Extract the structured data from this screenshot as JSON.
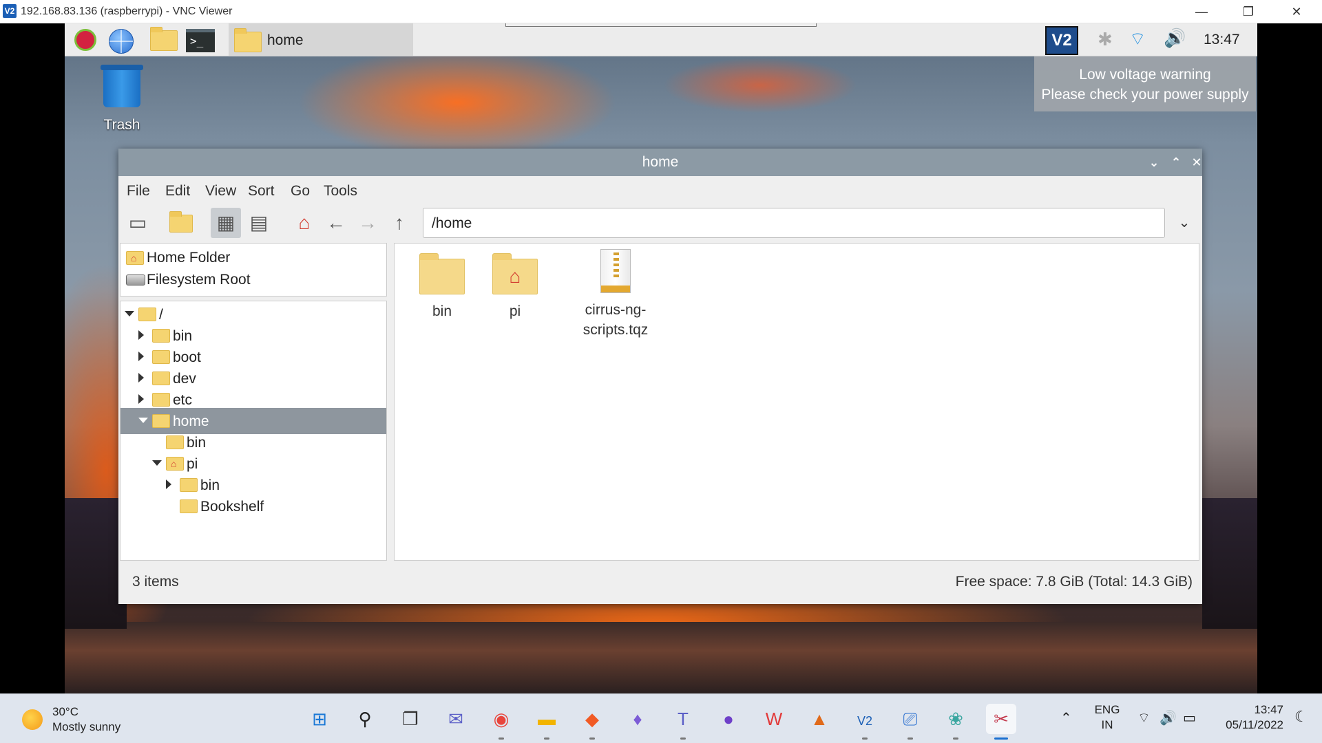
{
  "vnc": {
    "title": "192.168.83.136 (raspberrypi) - VNC Viewer",
    "logo": "V2",
    "controls": {
      "minimize": "—",
      "restore": "❐",
      "close": "✕"
    }
  },
  "pi_panel": {
    "launchers": [
      "raspberry-menu-icon",
      "web-browser-icon",
      "file-manager-icon",
      "terminal-icon"
    ],
    "terminal_glyph": ">_",
    "task_button": "home",
    "tray": {
      "vnc": "V2",
      "bluetooth": "✱",
      "wifi": "⌔",
      "volume": "🔊",
      "clock": "13:47"
    }
  },
  "tooltip": {
    "line1": "Low voltage warning",
    "line2": "Please check your power supply"
  },
  "desktop": {
    "trash_label": "Trash"
  },
  "file_manager": {
    "title": "home",
    "title_buttons": {
      "minimize": "⌄",
      "maximize": "⌃",
      "close": "✕"
    },
    "menu": [
      "File",
      "Edit",
      "View",
      "Sort",
      "Go",
      "Tools"
    ],
    "toolbar": {
      "new_window": "▭",
      "new_folder": "",
      "icon_view": "▦",
      "list_view": "▤",
      "home": "⌂",
      "back": "←",
      "forward": "→",
      "up": "↑"
    },
    "path": "/home",
    "places": [
      {
        "label": "Home Folder"
      },
      {
        "label": "Filesystem Root"
      }
    ],
    "tree": [
      {
        "label": "/",
        "level": 0,
        "state": "expanded"
      },
      {
        "label": "bin",
        "level": 1,
        "state": "collapsed"
      },
      {
        "label": "boot",
        "level": 1,
        "state": "collapsed"
      },
      {
        "label": "dev",
        "level": 1,
        "state": "collapsed"
      },
      {
        "label": "etc",
        "level": 1,
        "state": "collapsed"
      },
      {
        "label": "home",
        "level": 1,
        "state": "expanded",
        "selected": true
      },
      {
        "label": "bin",
        "level": 2,
        "state": "leaf"
      },
      {
        "label": "pi",
        "level": 2,
        "state": "expanded",
        "home": true
      },
      {
        "label": "bin",
        "level": 3,
        "state": "collapsed"
      },
      {
        "label": "Bookshelf",
        "level": 3,
        "state": "leaf"
      }
    ],
    "files": [
      {
        "name": "bin",
        "type": "folder"
      },
      {
        "name": "pi",
        "type": "home-folder"
      },
      {
        "name": "cirrus-ng-scripts.tqz",
        "type": "archive"
      }
    ],
    "status_left": "3 items",
    "status_right": "Free space: 7.8 GiB (Total: 14.3 GiB)"
  },
  "windows_taskbar": {
    "weather": {
      "temp": "30°C",
      "desc": "Mostly sunny"
    },
    "apps": [
      {
        "name": "start",
        "glyph": "⊞",
        "color": "#1a78d6"
      },
      {
        "name": "search",
        "glyph": "⚲",
        "color": "#222222"
      },
      {
        "name": "task-view",
        "glyph": "❐",
        "color": "#333333"
      },
      {
        "name": "chat",
        "glyph": "✉",
        "color": "#5b5fc7"
      },
      {
        "name": "chrome",
        "glyph": "◉",
        "color": "#e8453c"
      },
      {
        "name": "file-explorer",
        "glyph": "▬",
        "color": "#f2b400"
      },
      {
        "name": "brave",
        "glyph": "◆",
        "color": "#f15a24"
      },
      {
        "name": "obsidian",
        "glyph": "♦",
        "color": "#7c5cd6"
      },
      {
        "name": "teams",
        "glyph": "T",
        "color": "#5b5fc7"
      },
      {
        "name": "github-desktop",
        "glyph": "●",
        "color": "#6e40c9"
      },
      {
        "name": "wps",
        "glyph": "W",
        "color": "#e23b3b"
      },
      {
        "name": "matlab",
        "glyph": "▲",
        "color": "#e06a1a"
      },
      {
        "name": "vnc-viewer",
        "glyph": "V2",
        "color": "#1b5fb6"
      },
      {
        "name": "remote-desktop",
        "glyph": "⎚",
        "color": "#2a6fd0"
      },
      {
        "name": "paw-app",
        "glyph": "❀",
        "color": "#3aa6a0"
      },
      {
        "name": "snipping-tool",
        "glyph": "✂",
        "color": "#c3364a"
      }
    ],
    "tray": {
      "chevron": "⌃",
      "lang1": "ENG",
      "lang2": "IN",
      "wifi": "⌔",
      "volume": "🔊",
      "battery": "▭",
      "time": "13:47",
      "date": "05/11/2022",
      "moon": "☾"
    }
  }
}
